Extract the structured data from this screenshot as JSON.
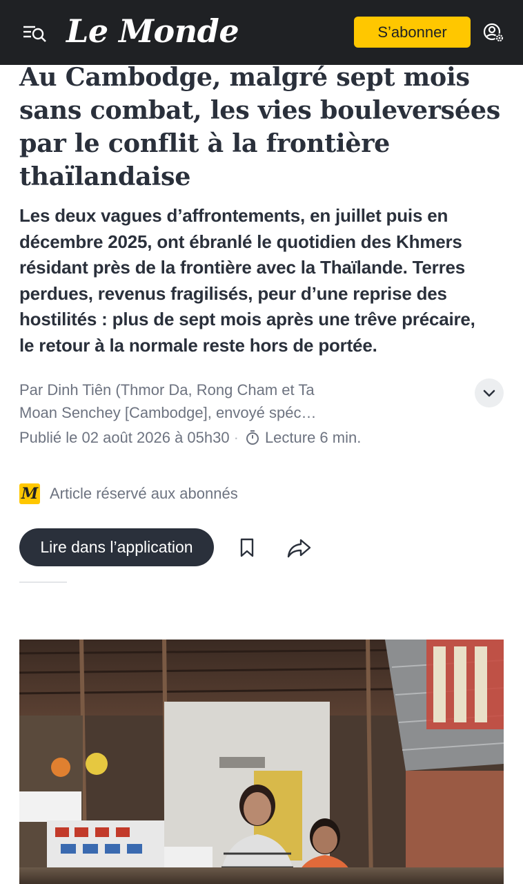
{
  "header": {
    "logo": "Le Monde",
    "subscribe_label": "S’abonner",
    "colors": {
      "background": "#1f2124",
      "accent": "#ffc700"
    }
  },
  "article": {
    "title_lines": [
      "Au Cambodge, malgré sept mois",
      "sans combat, les vies bouleversées",
      "par le conflit à la frontière",
      "thaïlandaise"
    ],
    "lead_lines": [
      "Les deux vagues d’affrontements, en juillet puis en",
      "décembre 2025, ont ébranlé le quotidien des Khmers",
      "résidant près de la frontière avec la Thaïlande. Terres",
      "perdues, revenus fragilisés, peur d’une reprise des",
      "hostilités : plus de sept mois après une trêve précaire,",
      "le retour à la normale reste hors de portée."
    ],
    "byline_lines": [
      "Par Dinh Tiên (Thmor Da, Rong Cham et Ta",
      "Moan Senchey [Cambodge], envoyé spéc…"
    ],
    "published": "Publié le 02 août 2026 à 05h30",
    "separator": "·",
    "reading_time": "Lecture 6 min.",
    "premium_badge": "M",
    "premium_label": "Article réservé aux abonnés",
    "read_in_app_label": "Lire dans l’application"
  },
  "icons": {
    "menu": "menu-search-icon",
    "account": "account-settings-icon",
    "expand": "chevron-down-icon",
    "timer": "stopwatch-icon",
    "bookmark": "bookmark-icon",
    "share": "share-arrow-icon"
  }
}
